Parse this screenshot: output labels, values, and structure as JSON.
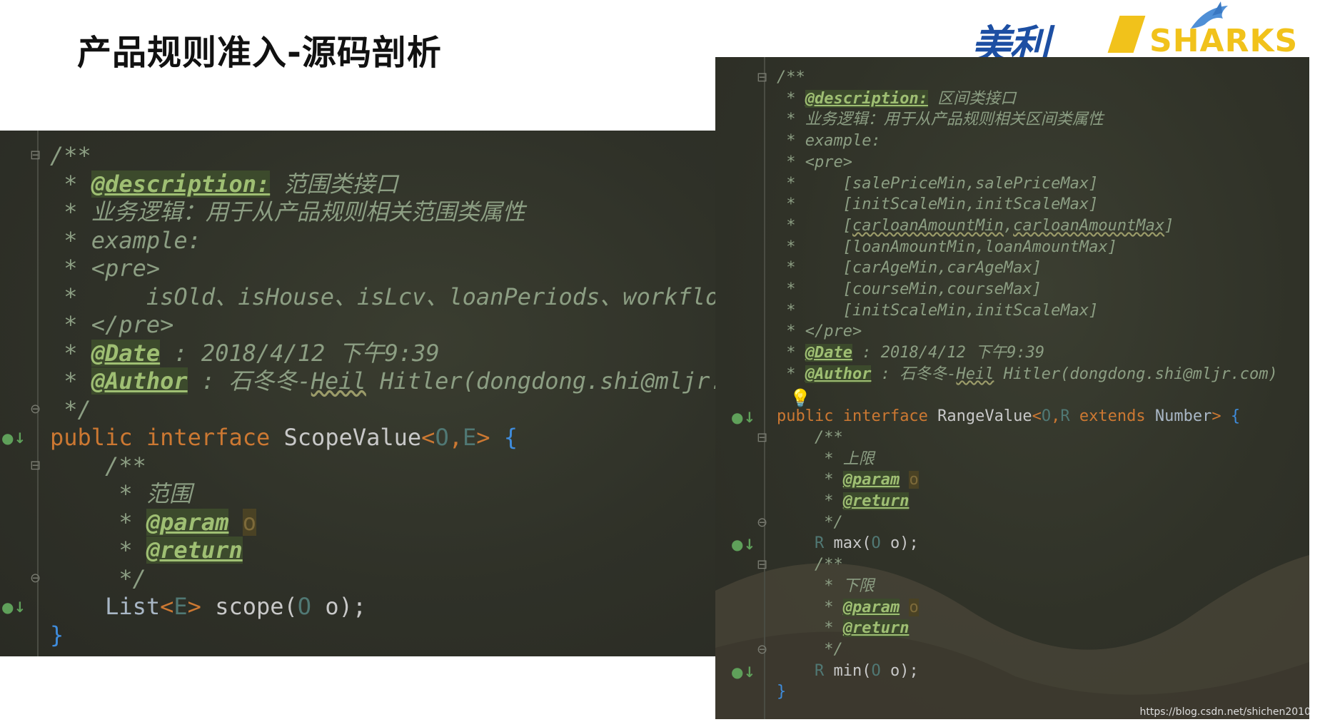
{
  "slide": {
    "title": "产品规则准入-源码剖析"
  },
  "logo": {
    "cn": "美利",
    "en": "SHARKS"
  },
  "left_code": {
    "lines": [
      [
        {
          "t": "/**",
          "c": "c-doc"
        }
      ],
      [
        {
          "t": " * ",
          "c": "c-doc"
        },
        {
          "t": "@description:",
          "c": "c-tag"
        },
        {
          "t": " 范围类接口",
          "c": "c-doc"
        }
      ],
      [
        {
          "t": " * 业务逻辑：用于从产品规则相关范围类属性",
          "c": "c-doc"
        }
      ],
      [
        {
          "t": " * example:",
          "c": "c-doc"
        }
      ],
      [
        {
          "t": " * <pre>",
          "c": "c-doc"
        }
      ],
      [
        {
          "t": " *     isOld、isHouse、isLcv、loanPeriods、workflow",
          "c": "c-doc"
        }
      ],
      [
        {
          "t": " * </pre>",
          "c": "c-doc"
        }
      ],
      [
        {
          "t": " * ",
          "c": "c-doc"
        },
        {
          "t": "@Date",
          "c": "c-tag"
        },
        {
          "t": " : 2018/4/12 下午9:39",
          "c": "c-doc"
        }
      ],
      [
        {
          "t": " * ",
          "c": "c-doc"
        },
        {
          "t": "@Author",
          "c": "c-tag"
        },
        {
          "t": " : 石冬冬-",
          "c": "c-doc"
        },
        {
          "t": "Heil",
          "c": "c-doc c-err"
        },
        {
          "t": " Hitler(dongdong.shi@mljr.co",
          "c": "c-doc"
        }
      ],
      [
        {
          "t": " */",
          "c": "c-doc"
        }
      ],
      [
        {
          "t": "public ",
          "c": "c-kw"
        },
        {
          "t": "interface ",
          "c": "c-kw"
        },
        {
          "t": "ScopeValue",
          "c": "c-name"
        },
        {
          "t": "<",
          "c": "c-kw"
        },
        {
          "t": "O",
          "c": "c-gen"
        },
        {
          "t": ",",
          "c": "c-kw"
        },
        {
          "t": "E",
          "c": "c-gen"
        },
        {
          "t": ">",
          "c": "c-kw"
        },
        {
          "t": " {",
          "c": "c-brace"
        }
      ],
      [
        {
          "t": "    /**",
          "c": "c-doc"
        }
      ],
      [
        {
          "t": "     * 范围",
          "c": "c-doc"
        }
      ],
      [
        {
          "t": "     * ",
          "c": "c-doc"
        },
        {
          "t": "@param",
          "c": "c-tag"
        },
        {
          "t": " ",
          "c": "c-doc"
        },
        {
          "t": "o",
          "c": "c-mute"
        }
      ],
      [
        {
          "t": "     * ",
          "c": "c-doc"
        },
        {
          "t": "@return",
          "c": "c-tag"
        }
      ],
      [
        {
          "t": "     */",
          "c": "c-doc"
        }
      ],
      [
        {
          "t": "    List",
          "c": "c-type"
        },
        {
          "t": "<",
          "c": "c-kw"
        },
        {
          "t": "E",
          "c": "c-gen"
        },
        {
          "t": ">",
          "c": "c-kw"
        },
        {
          "t": " scope(",
          "c": "c-plain"
        },
        {
          "t": "O",
          "c": "c-gen"
        },
        {
          "t": " o);",
          "c": "c-plain"
        }
      ],
      [
        {
          "t": "}",
          "c": "c-brace"
        }
      ]
    ],
    "gutter": [
      {
        "line": 0,
        "icon": "fold-open",
        "glyph": "⊟"
      },
      {
        "line": 9,
        "icon": "fold-close",
        "glyph": "⊖"
      },
      {
        "line": 10,
        "icon": "implemented-marker",
        "glyph": "●↓"
      },
      {
        "line": 11,
        "icon": "fold-open",
        "glyph": "⊟"
      },
      {
        "line": 15,
        "icon": "fold-close",
        "glyph": "⊖"
      },
      {
        "line": 16,
        "icon": "implemented-marker",
        "glyph": "●↓"
      }
    ]
  },
  "right_code": {
    "lines": [
      [
        {
          "t": "/**",
          "c": "c-doc"
        }
      ],
      [
        {
          "t": " * ",
          "c": "c-doc"
        },
        {
          "t": "@description:",
          "c": "c-tag"
        },
        {
          "t": " 区间类接口",
          "c": "c-doc"
        }
      ],
      [
        {
          "t": " * 业务逻辑：用于从产品规则相关区间类属性",
          "c": "c-doc"
        }
      ],
      [
        {
          "t": " * example:",
          "c": "c-doc"
        }
      ],
      [
        {
          "t": " * <pre>",
          "c": "c-doc"
        }
      ],
      [
        {
          "t": " *     [salePriceMin,salePriceMax]",
          "c": "c-doc"
        }
      ],
      [
        {
          "t": " *     [initScaleMin,initScaleMax]",
          "c": "c-doc"
        }
      ],
      [
        {
          "t": " *     [",
          "c": "c-doc"
        },
        {
          "t": "carloanAmountMin",
          "c": "c-doc c-err"
        },
        {
          "t": ",",
          "c": "c-doc"
        },
        {
          "t": "carloanAmountMax",
          "c": "c-doc c-err"
        },
        {
          "t": "]",
          "c": "c-doc"
        }
      ],
      [
        {
          "t": " *     [loanAmountMin,loanAmountMax]",
          "c": "c-doc"
        }
      ],
      [
        {
          "t": " *     [carAgeMin,carAgeMax]",
          "c": "c-doc"
        }
      ],
      [
        {
          "t": " *     [courseMin,courseMax]",
          "c": "c-doc"
        }
      ],
      [
        {
          "t": " *     [initScaleMin,initScaleMax]",
          "c": "c-doc"
        }
      ],
      [
        {
          "t": " * </pre>",
          "c": "c-doc"
        }
      ],
      [
        {
          "t": " * ",
          "c": "c-doc"
        },
        {
          "t": "@Date",
          "c": "c-tag"
        },
        {
          "t": " : 2018/4/12 下午9:39",
          "c": "c-doc"
        }
      ],
      [
        {
          "t": " * ",
          "c": "c-doc"
        },
        {
          "t": "@Author",
          "c": "c-tag"
        },
        {
          "t": " : 石冬冬-",
          "c": "c-doc"
        },
        {
          "t": "Heil",
          "c": "c-doc c-err"
        },
        {
          "t": " Hitler(dongdong.shi@mljr.com)",
          "c": "c-doc"
        }
      ],
      [
        {
          "t": " ",
          "c": "c-doc"
        }
      ],
      [
        {
          "t": "public ",
          "c": "c-kw"
        },
        {
          "t": "interface ",
          "c": "c-kw"
        },
        {
          "t": "RangeValue",
          "c": "c-name"
        },
        {
          "t": "<",
          "c": "c-kw"
        },
        {
          "t": "O",
          "c": "c-gen"
        },
        {
          "t": ",",
          "c": "c-kw"
        },
        {
          "t": "R",
          "c": "c-gen"
        },
        {
          "t": " extends ",
          "c": "c-kw"
        },
        {
          "t": "Number",
          "c": "c-type"
        },
        {
          "t": ">",
          "c": "c-kw"
        },
        {
          "t": " {",
          "c": "c-brace"
        }
      ],
      [
        {
          "t": "    /**",
          "c": "c-doc"
        }
      ],
      [
        {
          "t": "     * 上限",
          "c": "c-doc"
        }
      ],
      [
        {
          "t": "     * ",
          "c": "c-doc"
        },
        {
          "t": "@param",
          "c": "c-tag"
        },
        {
          "t": " ",
          "c": "c-doc"
        },
        {
          "t": "o",
          "c": "c-mute"
        }
      ],
      [
        {
          "t": "     * ",
          "c": "c-doc"
        },
        {
          "t": "@return",
          "c": "c-tag"
        }
      ],
      [
        {
          "t": "     */",
          "c": "c-doc"
        }
      ],
      [
        {
          "t": "    R",
          "c": "c-gen"
        },
        {
          "t": " max(",
          "c": "c-plain"
        },
        {
          "t": "O",
          "c": "c-gen"
        },
        {
          "t": " o);",
          "c": "c-plain"
        }
      ],
      [
        {
          "t": "    /**",
          "c": "c-doc"
        }
      ],
      [
        {
          "t": "     * 下限",
          "c": "c-doc"
        }
      ],
      [
        {
          "t": "     * ",
          "c": "c-doc"
        },
        {
          "t": "@param",
          "c": "c-tag"
        },
        {
          "t": " ",
          "c": "c-doc"
        },
        {
          "t": "o",
          "c": "c-mute"
        }
      ],
      [
        {
          "t": "     * ",
          "c": "c-doc"
        },
        {
          "t": "@return",
          "c": "c-tag"
        }
      ],
      [
        {
          "t": "     */",
          "c": "c-doc"
        }
      ],
      [
        {
          "t": "    R",
          "c": "c-gen"
        },
        {
          "t": " min(",
          "c": "c-plain"
        },
        {
          "t": "O",
          "c": "c-gen"
        },
        {
          "t": " o);",
          "c": "c-plain"
        }
      ],
      [
        {
          "t": "}",
          "c": "c-brace"
        }
      ]
    ],
    "gutter": [
      {
        "line": 0,
        "icon": "fold-open",
        "glyph": "⊟"
      },
      {
        "line": 15,
        "icon": "lightbulb-icon",
        "glyph": "💡"
      },
      {
        "line": 16,
        "icon": "implemented-marker",
        "glyph": "●↓"
      },
      {
        "line": 17,
        "icon": "fold-open",
        "glyph": "⊟"
      },
      {
        "line": 21,
        "icon": "fold-close",
        "glyph": "⊖"
      },
      {
        "line": 22,
        "icon": "implemented-marker",
        "glyph": "●↓"
      },
      {
        "line": 23,
        "icon": "fold-open",
        "glyph": "⊟"
      },
      {
        "line": 27,
        "icon": "fold-close",
        "glyph": "⊖"
      },
      {
        "line": 28,
        "icon": "implemented-marker",
        "glyph": "●↓"
      }
    ]
  },
  "watermark": "https://blog.csdn.net/shichen2010"
}
